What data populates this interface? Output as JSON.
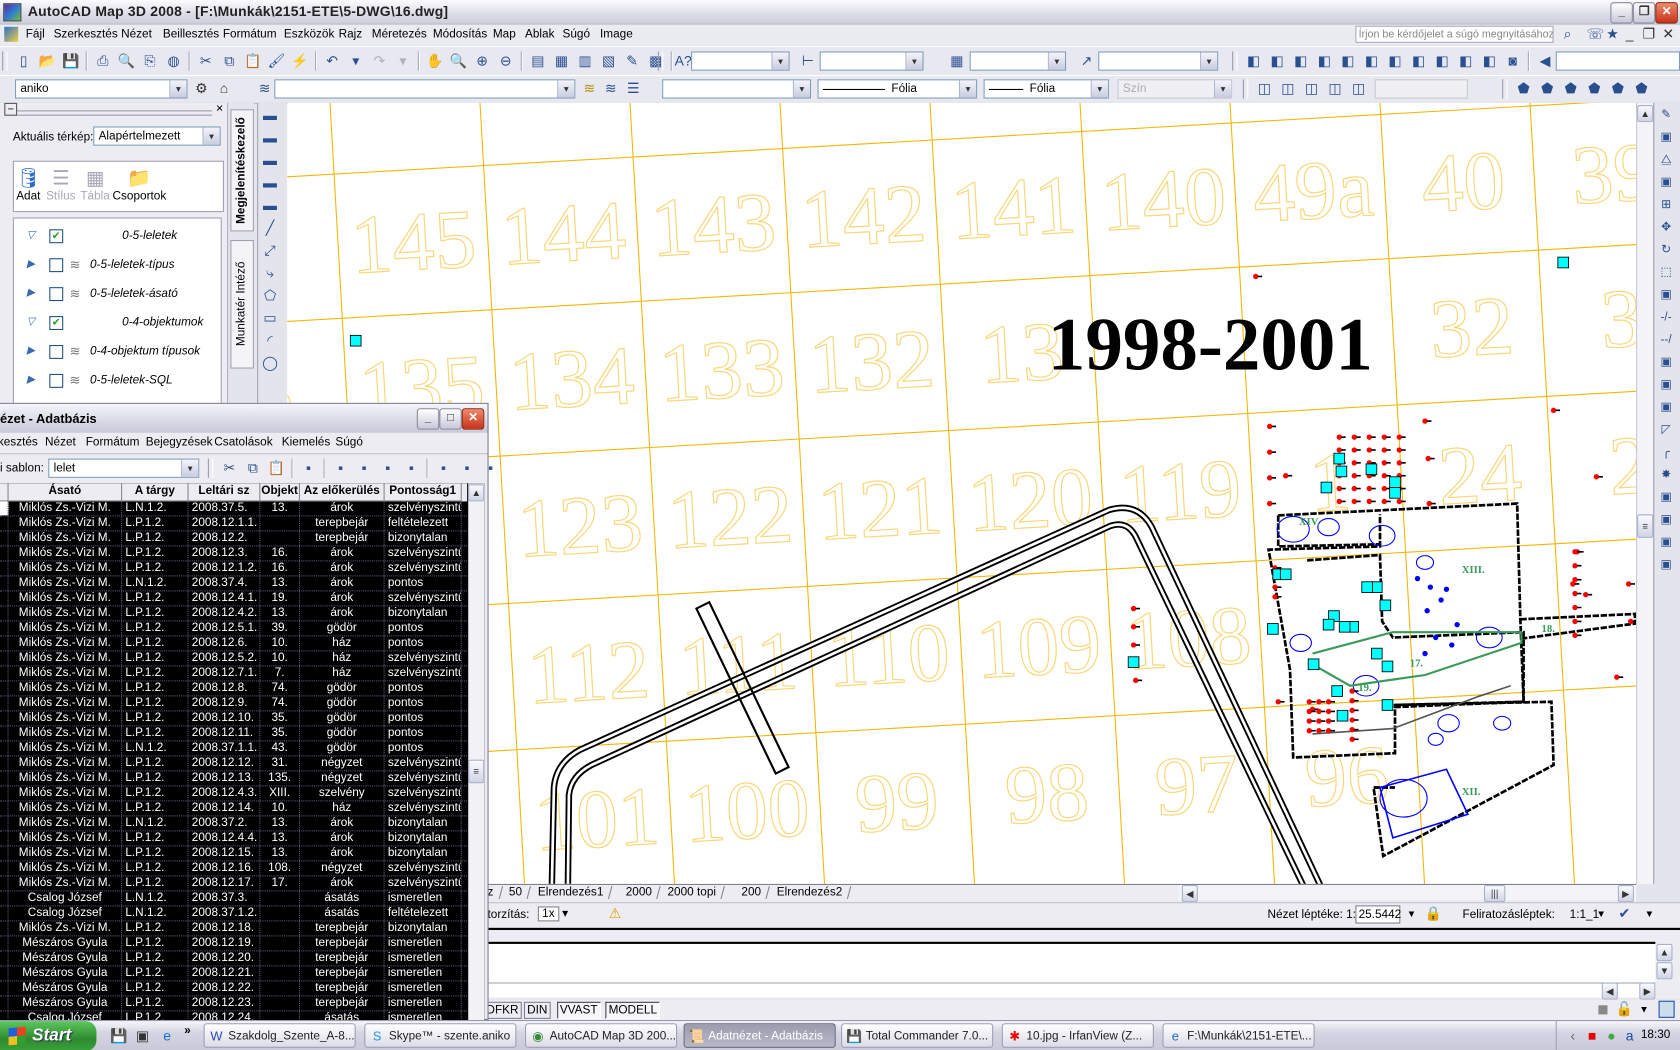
{
  "app": {
    "title": "AutoCAD Map 3D 2008 - [F:\\Munkák\\2151-ETE\\5-DWG\\16.dwg]"
  },
  "menu": [
    "Fájl",
    "Szerkesztés",
    "Nézet",
    "Beillesztés",
    "Formátum",
    "Eszközök",
    "Rajz",
    "Méretezés",
    "Módosítás",
    "Map",
    "Ablak",
    "Súgó",
    "Image"
  ],
  "help_search": {
    "placeholder": "Írjon be kérdőjelet a súgó megnyitásához"
  },
  "toolbar1": {
    "standard_icons": [
      "new-icon",
      "open-icon",
      "save-icon",
      "|",
      "plot-icon",
      "plot-preview-icon",
      "publish-icon",
      "3d-dwf-icon",
      "|",
      "cut-icon",
      "copy-icon",
      "paste-icon",
      "match-properties-icon",
      "block-editor-icon",
      "|",
      "undo-icon",
      "undo-dropdown-icon",
      "redo-icon",
      "redo-dropdown-icon",
      "|",
      "pan-icon",
      "zoom-realtime-icon",
      "zoom-window-icon",
      "zoom-previous-icon",
      "|",
      "properties-icon",
      "design-center-icon",
      "tool-palettes-icon",
      "sheet-set-icon",
      "markup-icon",
      "quickcalc-icon",
      "|",
      "help-icon"
    ],
    "styles": {
      "text_style": "",
      "dim_style": "",
      "table_style": "",
      "mleader_style": ""
    },
    "view_icons": [
      "named-views-icon",
      "top-view-icon",
      "bottom-view-icon",
      "left-view-icon",
      "right-view-icon",
      "front-view-icon",
      "back-view-icon",
      "sw-iso-icon",
      "se-iso-icon",
      "ne-iso-icon",
      "nw-iso-icon",
      "camera-icon",
      "|",
      "previous-view-icon"
    ],
    "view_field": ""
  },
  "toolbar2": {
    "workspace": "aniko",
    "layer": "",
    "color": "",
    "linetype": "Fólia",
    "lineweight": "Fólia",
    "plotstyle": "Szín",
    "extra_combo": ""
  },
  "palette": {
    "current_map_label": "Aktuális térkép:",
    "current_map": "Alapértelmezett",
    "tools": [
      {
        "label": "Adat",
        "enabled": true,
        "icon": "database-icon"
      },
      {
        "label": "Stílus",
        "enabled": false,
        "icon": "style-icon"
      },
      {
        "label": "Tábla",
        "enabled": false,
        "icon": "table-icon"
      },
      {
        "label": "Csoportok",
        "enabled": true,
        "icon": "groups-icon"
      }
    ],
    "layers": [
      {
        "label": "0-5-leletek",
        "checked": true,
        "group": true
      },
      {
        "label": "0-5-leletek-típus",
        "checked": false,
        "group": false
      },
      {
        "label": "0-5-leletek-ásató",
        "checked": false,
        "group": false
      },
      {
        "label": "0-4-objektumok",
        "checked": true,
        "group": true
      },
      {
        "label": "0-4-objektum típusok",
        "checked": false,
        "group": false
      },
      {
        "label": "0-5-leletek-SQL",
        "checked": false,
        "group": false
      }
    ],
    "tabs": [
      "Megjelenítéskezelő",
      "Munkatér Intéző"
    ]
  },
  "drawing": {
    "grid_labels": [
      [
        "6",
        "145",
        "144",
        "143",
        "142",
        "141",
        "140",
        "49a",
        "40",
        "39"
      ],
      [
        "6",
        "135",
        "134",
        "133",
        "132",
        "13",
        "",
        "",
        "32",
        "3"
      ],
      [
        "",
        "",
        "123",
        "122",
        "121",
        "120",
        "119",
        "1",
        "24",
        "2"
      ],
      [
        "",
        "2",
        "112",
        "111",
        "110",
        "109",
        "108",
        "",
        "",
        ""
      ],
      [
        "",
        "2",
        "101",
        "100",
        "99",
        "98",
        "97",
        "96",
        "",
        ""
      ]
    ],
    "year_label": "1998-2001",
    "site_labels": [
      "XIV.",
      "XIII.",
      "18.",
      "17.",
      "19.",
      "XII."
    ],
    "colors": {
      "grid": "#f2b600",
      "grid_label": "#f7d77a",
      "find_marker": "#ff0000",
      "object_marker": "#00ffff",
      "trench": "#000000",
      "feature": "#0000ff",
      "section_label": "#3a9a5a"
    }
  },
  "layout_tabs": [
    "z",
    "50",
    "Elrendezés1",
    "2000",
    "2000 topi",
    "200",
    "Elrendezés2"
  ],
  "status": {
    "distortion_label": "torzítás:",
    "distortion": "1x",
    "view_scale_label": "Nézet léptéke: 1:",
    "view_scale": "25.5442",
    "annotation_scale_label": "Feliratozásléptek:",
    "annotation_scale": "1:1_1"
  },
  "status_toggles": [
    {
      "label": "DFKR",
      "on": false
    },
    {
      "label": "DIN",
      "on": false
    },
    {
      "label": "VVAST",
      "on": true
    },
    {
      "label": "MODELL",
      "on": true
    }
  ],
  "taskbar": {
    "start": "Start",
    "tasks": [
      {
        "label": "Szakdolg_Szente_A-8...",
        "icon": "word-icon",
        "active": false
      },
      {
        "label": "Skype™ - szente.aniko",
        "icon": "skype-icon",
        "active": false
      },
      {
        "label": "AutoCAD Map 3D 200...",
        "icon": "autocad-icon",
        "active": false
      },
      {
        "label": "Adatnézet - Adatbázis",
        "icon": "scroll-icon",
        "active": true
      },
      {
        "label": "Total Commander 7.0...",
        "icon": "floppy-icon",
        "active": false
      },
      {
        "label": "10.jpg - IrfanView (Z...",
        "icon": "irfanview-icon",
        "active": false
      },
      {
        "label": "F:\\Munkák\\2151-ETE\\...",
        "icon": "ie-icon",
        "active": false
      }
    ],
    "clock": "18:30"
  },
  "dialog": {
    "title": "ézet - Adatbázis",
    "menu": [
      "kesztés",
      "Nézet",
      "Formátum",
      "Bejegyzések",
      "Csatolások",
      "Kiemelés",
      "Súgó"
    ],
    "template_label": "i sablon:",
    "template": "lelet",
    "columns": [
      "Ásató",
      "A tárgy",
      "Leltári sz",
      "Objekt",
      "Az előkerülés",
      "Pontosság1"
    ],
    "rows": [
      [
        "Miklós Zs.-Vizi M.",
        "L.N.1.2.",
        "2008.37.5.",
        "13.",
        "árok",
        "szelvényszintű"
      ],
      [
        "Miklós Zs.-Vizi M.",
        "L.P.1.2.",
        "2008.12.1.1.",
        "",
        "terepbejár",
        "feltételezett"
      ],
      [
        "Miklós Zs.-Vizi M.",
        "L.P.1.2.",
        "2008.12.2.",
        "",
        "terepbejár",
        "bizonytalan"
      ],
      [
        "Miklós Zs.-Vizi M.",
        "L.P.1.2.",
        "2008.12.3.",
        "16.",
        "árok",
        "szelvényszintű"
      ],
      [
        "Miklós Zs.-Vizi M.",
        "L.P.1.2.",
        "2008.12.1.2.",
        "16.",
        "árok",
        "szelvényszintű"
      ],
      [
        "Miklós Zs.-Vizi M.",
        "L.N.1.2.",
        "2008.37.4.",
        "13.",
        "árok",
        "pontos"
      ],
      [
        "Miklós Zs.-Vizi M.",
        "L.P.1.2.",
        "2008.12.4.1.",
        "19.",
        "árok",
        "szelvényszintű"
      ],
      [
        "Miklós Zs.-Vizi M.",
        "L.P.1.2.",
        "2008.12.4.2.",
        "13.",
        "árok",
        "bizonytalan"
      ],
      [
        "Miklós Zs.-Vizi M.",
        "L.P.1.2.",
        "2008.12.5.1.",
        "39.",
        "gödör",
        "pontos"
      ],
      [
        "Miklós Zs.-Vizi M.",
        "L.P.1.2.",
        "2008.12.6.",
        "10.",
        "ház",
        "pontos"
      ],
      [
        "Miklós Zs.-Vizi M.",
        "L.P.1.2.",
        "2008.12.5.2.",
        "10.",
        "ház",
        "szelvényszintű"
      ],
      [
        "Miklós Zs.-Vizi M.",
        "L.P.1.2.",
        "2008.12.7.1.",
        "7.",
        "ház",
        "szelvényszintű"
      ],
      [
        "Miklós Zs.-Vizi M.",
        "L.P.1.2.",
        "2008.12.8.",
        "74.",
        "gödör",
        "pontos"
      ],
      [
        "Miklós Zs.-Vizi M.",
        "L.P.1.2.",
        "2008.12.9.",
        "74.",
        "gödör",
        "pontos"
      ],
      [
        "Miklós Zs.-Vizi M.",
        "L.P.1.2.",
        "2008.12.10.",
        "35.",
        "gödör",
        "pontos"
      ],
      [
        "Miklós Zs.-Vizi M.",
        "L.P.1.2.",
        "2008.12.11.",
        "35.",
        "gödör",
        "pontos"
      ],
      [
        "Miklós Zs.-Vizi M.",
        "L.N.1.2.",
        "2008.37.1.1.",
        "43.",
        "gödör",
        "pontos"
      ],
      [
        "Miklós Zs.-Vizi M.",
        "L.P.1.2.",
        "2008.12.12.",
        "31.",
        "négyzet",
        "szelvényszintű"
      ],
      [
        "Miklós Zs.-Vizi M.",
        "L.P.1.2.",
        "2008.12.13.",
        "135.",
        "négyzet",
        "szelvényszintű"
      ],
      [
        "Miklós Zs.-Vizi M.",
        "L.P.1.2.",
        "2008.12.4.3.",
        "XIII.",
        "szelvény",
        "szelvényszintű"
      ],
      [
        "Miklós Zs.-Vizi M.",
        "L.P.1.2.",
        "2008.12.14.",
        "10.",
        "ház",
        "szelvényszintű"
      ],
      [
        "Miklós Zs.-Vizi M.",
        "L.N.1.2.",
        "2008.37.2.",
        "13.",
        "árok",
        "bizonytalan"
      ],
      [
        "Miklós Zs.-Vizi M.",
        "L.P.1.2.",
        "2008.12.4.4.",
        "13.",
        "árok",
        "bizonytalan"
      ],
      [
        "Miklós Zs.-Vizi M.",
        "L.P.1.2.",
        "2008.12.15.",
        "13.",
        "árok",
        "bizonytalan"
      ],
      [
        "Miklós Zs.-Vizi M.",
        "L.P.1.2.",
        "2008.12.16.",
        "108.",
        "négyzet",
        "szelvényszintű"
      ],
      [
        "Miklós Zs.-Vizi M.",
        "L.P.1.2.",
        "2008.12.17.",
        "17.",
        "árok",
        "szelvényszintű"
      ],
      [
        "Csalog József",
        "L.N.1.2.",
        "2008.37.3.",
        "",
        "ásatás",
        "ismeretlen"
      ],
      [
        "Csalog József",
        "L.N.1.2.",
        "2008.37.1.2.",
        "",
        "ásatás",
        "feltételezett"
      ],
      [
        "Miklós Zs.-Vizi M.",
        "L.P.1.2.",
        "2008.12.18.",
        "",
        "terepbejár",
        "bizonytalan"
      ],
      [
        "Mészáros Gyula",
        "L.P.1.2.",
        "2008.12.19.",
        "",
        "terepbejár",
        "ismeretlen"
      ],
      [
        "Mészáros Gyula",
        "L.P.1.2.",
        "2008.12.20.",
        "",
        "terepbejár",
        "ismeretlen"
      ],
      [
        "Mészáros Gyula",
        "L.P.1.2.",
        "2008.12.21.",
        "",
        "terepbejár",
        "ismeretlen"
      ],
      [
        "Mészáros Gyula",
        "L.P.1.2.",
        "2008.12.22.",
        "",
        "terepbejár",
        "ismeretlen"
      ],
      [
        "Mészáros Gyula",
        "L.P.1.2.",
        "2008.12.23.",
        "",
        "terepbejár",
        "ismeretlen"
      ],
      [
        "Csalog József",
        "L.P.1.2.",
        "2008.12.24.",
        "",
        "ásatás",
        "ismeretlen"
      ]
    ]
  }
}
